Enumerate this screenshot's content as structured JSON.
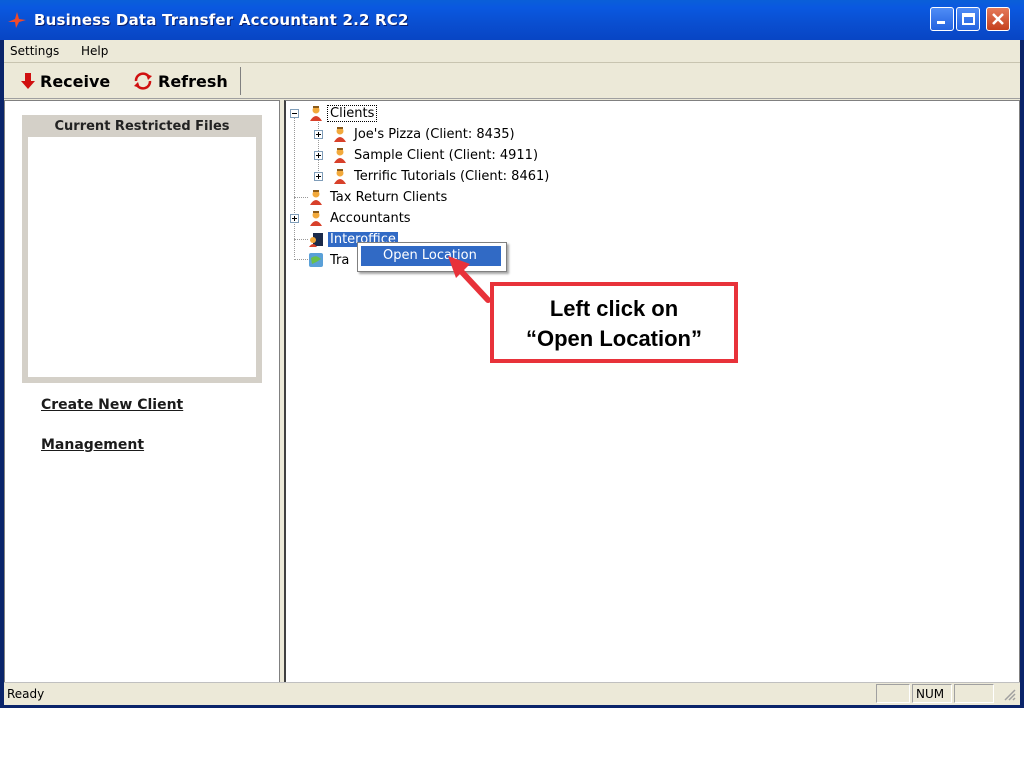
{
  "window": {
    "title": "Business Data Transfer Accountant 2.2 RC2",
    "colors": {
      "titlebar": "#0a58e0",
      "face": "#ece9d8",
      "selection": "#316ac5",
      "callout_border": "#e8323a"
    }
  },
  "menubar": {
    "items": [
      "Settings",
      "Help"
    ]
  },
  "toolbar": {
    "receive_label": "Receive",
    "refresh_label": "Refresh"
  },
  "left_pane": {
    "restricted_title": "Current Restricted Files",
    "links": [
      "Create New Client",
      "Management"
    ]
  },
  "tree": {
    "clients": "Clients",
    "clients_children": [
      "Joe's Pizza (Client: 8435)",
      "Sample Client (Client: 4911)",
      "Terrific Tutorials (Client: 8461)"
    ],
    "tax_return": "Tax Return Clients",
    "accountants": "Accountants",
    "interoffice": "Interoffice",
    "trash_partial": "Tra"
  },
  "context_menu": {
    "item": "Open Location"
  },
  "callout": {
    "line1": "Left click on",
    "line2": "“Open Location”"
  },
  "statusbar": {
    "text": "Ready",
    "num": "NUM"
  }
}
